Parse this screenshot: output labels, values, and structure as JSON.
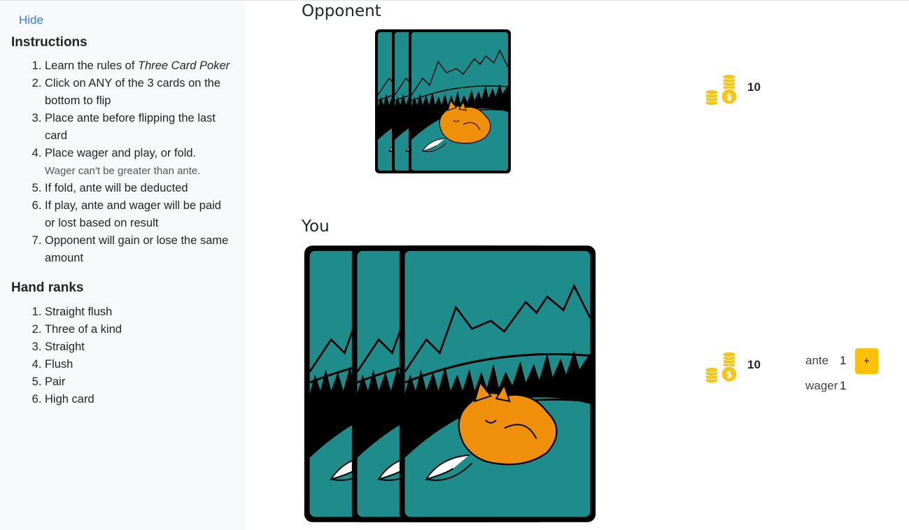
{
  "sidebar": {
    "hide_label": "Hide",
    "instructions_title": "Instructions",
    "instructions": [
      {
        "text": "Learn the rules of ",
        "emph": "Three Card Poker"
      },
      {
        "text": "Click on ANY of the 3 cards on the bottom to flip"
      },
      {
        "text": "Place ante before flipping the last card"
      },
      {
        "text": "Place wager and play, or fold.",
        "note": "Wager can't be greater than ante."
      },
      {
        "text": "If fold, ante will be deducted"
      },
      {
        "text": "If play, ante and wager will be paid or lost based on result"
      },
      {
        "text": "Opponent will gain or lose the same amount"
      }
    ],
    "ranks_title": "Hand ranks",
    "ranks": [
      "Straight flush",
      "Three of a kind",
      "Straight",
      "Flush",
      "Pair",
      "High card"
    ]
  },
  "opponent": {
    "label": "Opponent",
    "coins": "10",
    "cards_face_down": 3
  },
  "player": {
    "label": "You",
    "coins": "10",
    "cards_face_down": 3,
    "ante_label": "ante",
    "ante_value": "1",
    "plus_label": "+",
    "wager_label": "wager",
    "wager_value": "1"
  },
  "colors": {
    "card_teal": "#1f8c8c",
    "fox_orange": "#f0900a",
    "coin_gold": "#f5c518",
    "plus_button": "#ffc107",
    "link_blue": "#2f7fd1"
  }
}
